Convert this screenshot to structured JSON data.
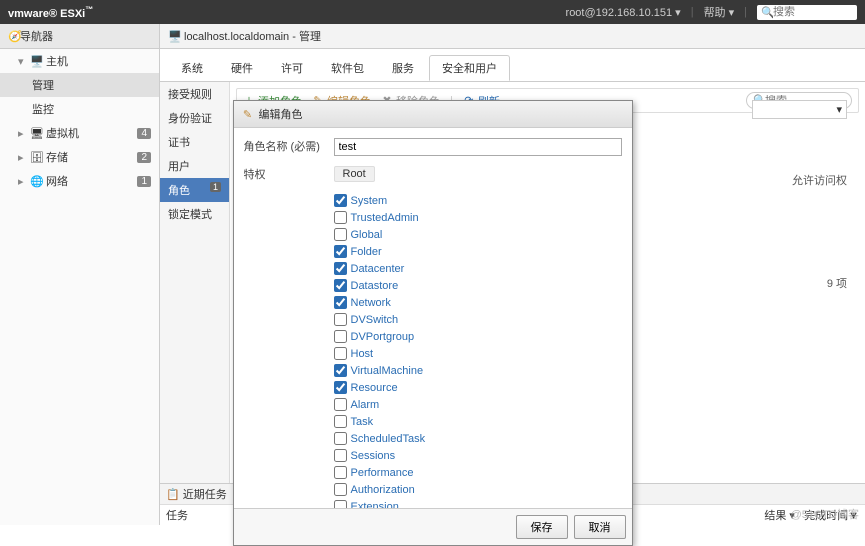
{
  "topbar": {
    "logo_brand": "vmware",
    "logo_product": "ESXi",
    "user": "root@192.168.10.151",
    "help": "帮助",
    "search_placeholder": "搜索"
  },
  "nav": {
    "header": "导航器",
    "host": "主机",
    "manage": "管理",
    "monitor": "监控",
    "vm": {
      "label": "虚拟机",
      "count": "4"
    },
    "storage": {
      "label": "存储",
      "count": "2"
    },
    "network": {
      "label": "网络",
      "count": "1"
    }
  },
  "breadcrumb": "localhost.localdomain - 管理",
  "tabs": {
    "system": "系统",
    "hardware": "硬件",
    "license": "许可",
    "packages": "软件包",
    "services": "服务",
    "security": "安全和用户"
  },
  "sublist": {
    "rules": "接受规则",
    "auth": "身份验证",
    "cert": "证书",
    "users": "用户",
    "roles": "角色",
    "lockdown": "锁定模式",
    "badge": "1"
  },
  "toolbar": {
    "add": "添加角色",
    "edit": "编辑角色",
    "delete": "移除角色",
    "refresh": "刷新",
    "search_placeholder": "搜索"
  },
  "access_label": "允许访问权",
  "item_count": "9 项",
  "modal": {
    "title": "编辑角色",
    "role_name_label": "角色名称 (必需)",
    "role_name_value": "test",
    "priv_label": "特权",
    "root": "Root",
    "privileges": [
      {
        "name": "System",
        "checked": true
      },
      {
        "name": "TrustedAdmin",
        "checked": false
      },
      {
        "name": "Global",
        "checked": false
      },
      {
        "name": "Folder",
        "checked": true
      },
      {
        "name": "Datacenter",
        "checked": true
      },
      {
        "name": "Datastore",
        "checked": true
      },
      {
        "name": "Network",
        "checked": true
      },
      {
        "name": "DVSwitch",
        "checked": false
      },
      {
        "name": "DVPortgroup",
        "checked": false
      },
      {
        "name": "Host",
        "checked": false
      },
      {
        "name": "VirtualMachine",
        "checked": true
      },
      {
        "name": "Resource",
        "checked": true
      },
      {
        "name": "Alarm",
        "checked": false
      },
      {
        "name": "Task",
        "checked": false
      },
      {
        "name": "ScheduledTask",
        "checked": false
      },
      {
        "name": "Sessions",
        "checked": false
      },
      {
        "name": "Performance",
        "checked": false
      },
      {
        "name": "Authorization",
        "checked": false
      },
      {
        "name": "Extension",
        "checked": false
      }
    ],
    "save": "保存",
    "cancel": "取消"
  },
  "recent": {
    "header": "近期任务",
    "task": "任务",
    "result": "结果",
    "complete": "完成时间"
  },
  "watermark": "@51CTO博客"
}
